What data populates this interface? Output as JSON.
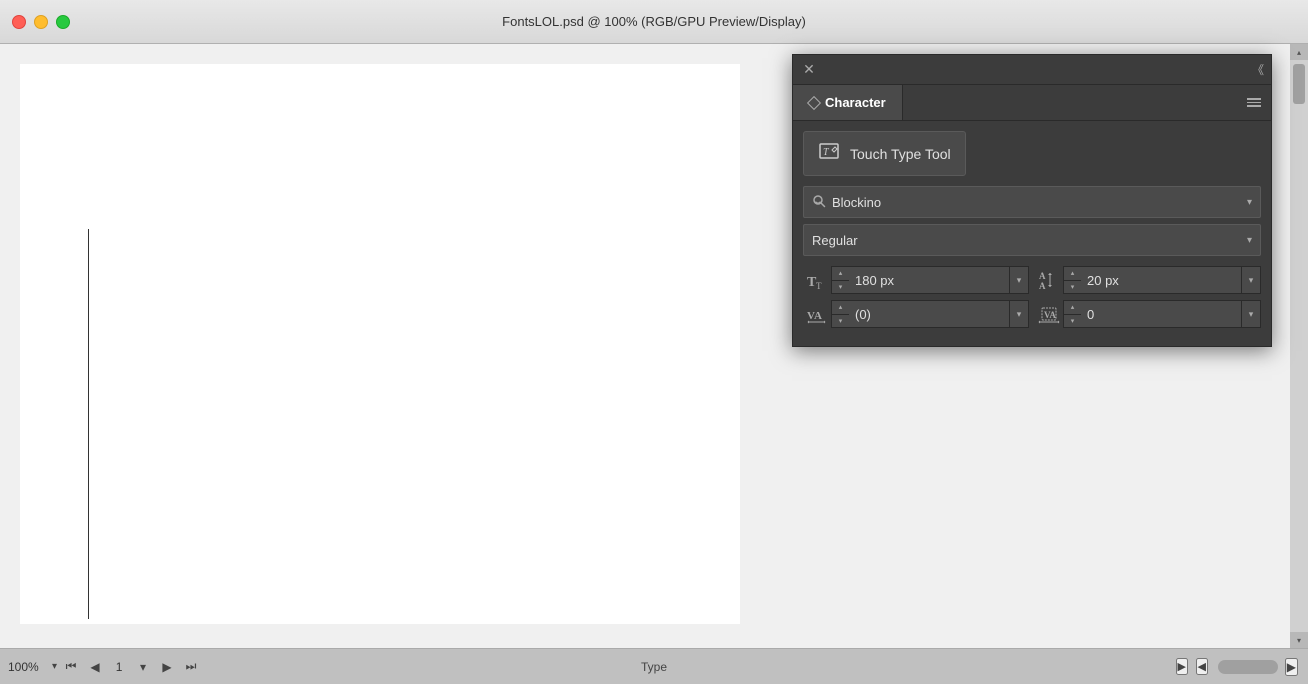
{
  "window": {
    "title": "FontsLOL.psd @ 100% (RGB/GPU Preview/Display)"
  },
  "titlebar": {
    "close_label": "×",
    "collapse_label": "«"
  },
  "panel": {
    "tab_label": "Character",
    "ttt_label": "Touch Type Tool",
    "font_family": "Blockino",
    "font_style": "Regular",
    "size_value": "180 px",
    "leading_value": "20 px",
    "kerning_value": "(0)",
    "tracking_value": "0"
  },
  "bottom_bar": {
    "zoom": "100%",
    "page": "1",
    "type_label": "Type"
  },
  "icons": {
    "close": "✕",
    "collapse": "《",
    "menu": "≡",
    "dropdown_arrow": "▾",
    "spin_up": "▴",
    "spin_down": "▾",
    "play": "▶",
    "play_back": "◀"
  }
}
